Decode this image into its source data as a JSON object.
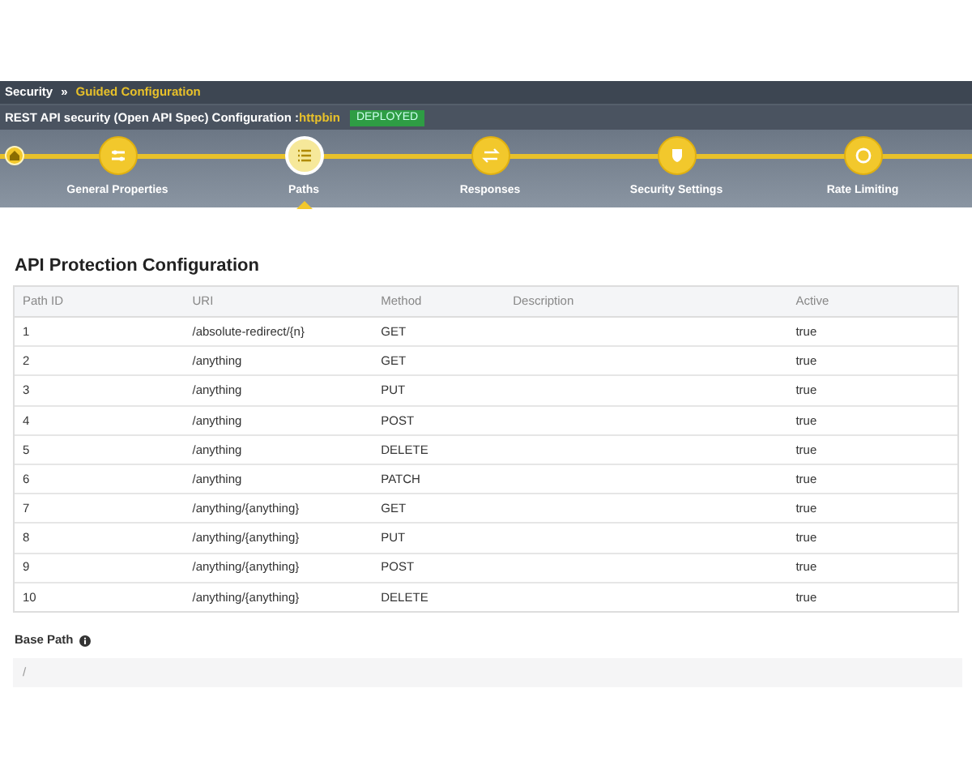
{
  "breadcrumb": {
    "items": [
      {
        "label": "Security",
        "selected": false
      },
      {
        "label": "Guided Configuration",
        "selected": true
      }
    ],
    "separator": "»"
  },
  "config": {
    "title": "REST API security (Open API Spec) Configuration :",
    "name": "httpbin",
    "status": "DEPLOYED"
  },
  "wizard": {
    "steps": [
      {
        "label": "General Properties",
        "selected": false
      },
      {
        "label": "Paths",
        "selected": true
      },
      {
        "label": "Responses",
        "selected": false
      },
      {
        "label": "Security Settings",
        "selected": false
      },
      {
        "label": "Rate Limiting",
        "selected": false
      }
    ]
  },
  "section_title": "API Protection Configuration",
  "table": {
    "columns": [
      "Path ID",
      "URI",
      "Method",
      "Description",
      "Active"
    ],
    "rows": [
      [
        "1",
        "/absolute-redirect/{n}",
        "GET",
        "",
        "true"
      ],
      [
        "2",
        "/anything",
        "GET",
        "",
        "true"
      ],
      [
        "3",
        "/anything",
        "PUT",
        "",
        "true"
      ],
      [
        "4",
        "/anything",
        "POST",
        "",
        "true"
      ],
      [
        "5",
        "/anything",
        "DELETE",
        "",
        "true"
      ],
      [
        "6",
        "/anything",
        "PATCH",
        "",
        "true"
      ],
      [
        "7",
        "/anything/{anything}",
        "GET",
        "",
        "true"
      ],
      [
        "8",
        "/anything/{anything}",
        "PUT",
        "",
        "true"
      ],
      [
        "9",
        "/anything/{anything}",
        "POST",
        "",
        "true"
      ],
      [
        "10",
        "/anything/{anything}",
        "DELETE",
        "",
        "true"
      ]
    ]
  },
  "base_path": {
    "label": "Base Path",
    "value": "/"
  }
}
